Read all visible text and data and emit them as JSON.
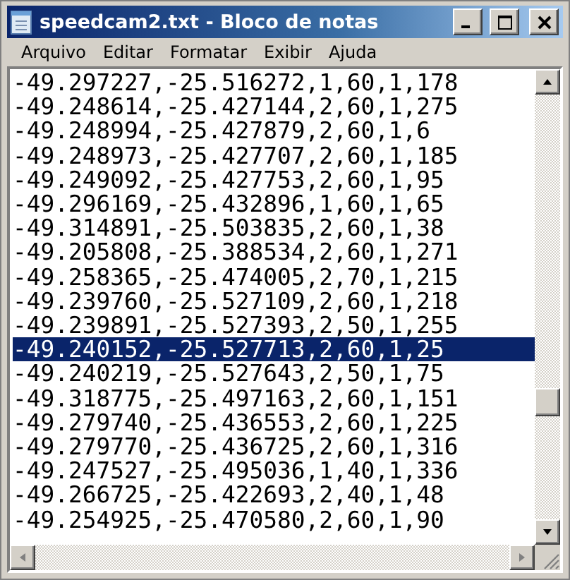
{
  "window": {
    "title": "speedcam2.txt - Bloco de notas"
  },
  "menu": [
    "Arquivo",
    "Editar",
    "Formatar",
    "Exibir",
    "Ajuda"
  ],
  "lines": [
    {
      "text": "-49.297227,-25.516272,1,60,1,178",
      "selected": false
    },
    {
      "text": "-49.248614,-25.427144,2,60,1,275",
      "selected": false
    },
    {
      "text": "-49.248994,-25.427879,2,60,1,6",
      "selected": false
    },
    {
      "text": "-49.248973,-25.427707,2,60,1,185",
      "selected": false
    },
    {
      "text": "-49.249092,-25.427753,2,60,1,95",
      "selected": false
    },
    {
      "text": "-49.296169,-25.432896,1,60,1,65",
      "selected": false
    },
    {
      "text": "-49.314891,-25.503835,2,60,1,38",
      "selected": false
    },
    {
      "text": "-49.205808,-25.388534,2,60,1,271",
      "selected": false
    },
    {
      "text": "-49.258365,-25.474005,2,70,1,215",
      "selected": false
    },
    {
      "text": "-49.239760,-25.527109,2,60,1,218",
      "selected": false
    },
    {
      "text": "-49.239891,-25.527393,2,50,1,255",
      "selected": false
    },
    {
      "text": "-49.240152,-25.527713,2,60,1,25",
      "selected": true
    },
    {
      "text": "-49.240219,-25.527643,2,50,1,75",
      "selected": false
    },
    {
      "text": "-49.318775,-25.497163,2,60,1,151",
      "selected": false
    },
    {
      "text": "-49.279740,-25.436553,2,60,1,225",
      "selected": false
    },
    {
      "text": "-49.279770,-25.436725,2,60,1,316",
      "selected": false
    },
    {
      "text": "-49.247527,-25.495036,1,40,1,336",
      "selected": false
    },
    {
      "text": "-49.266725,-25.422693,2,40,1,48",
      "selected": false
    },
    {
      "text": "-49.254925,-25.470580,2,60,1,90",
      "selected": false
    }
  ]
}
